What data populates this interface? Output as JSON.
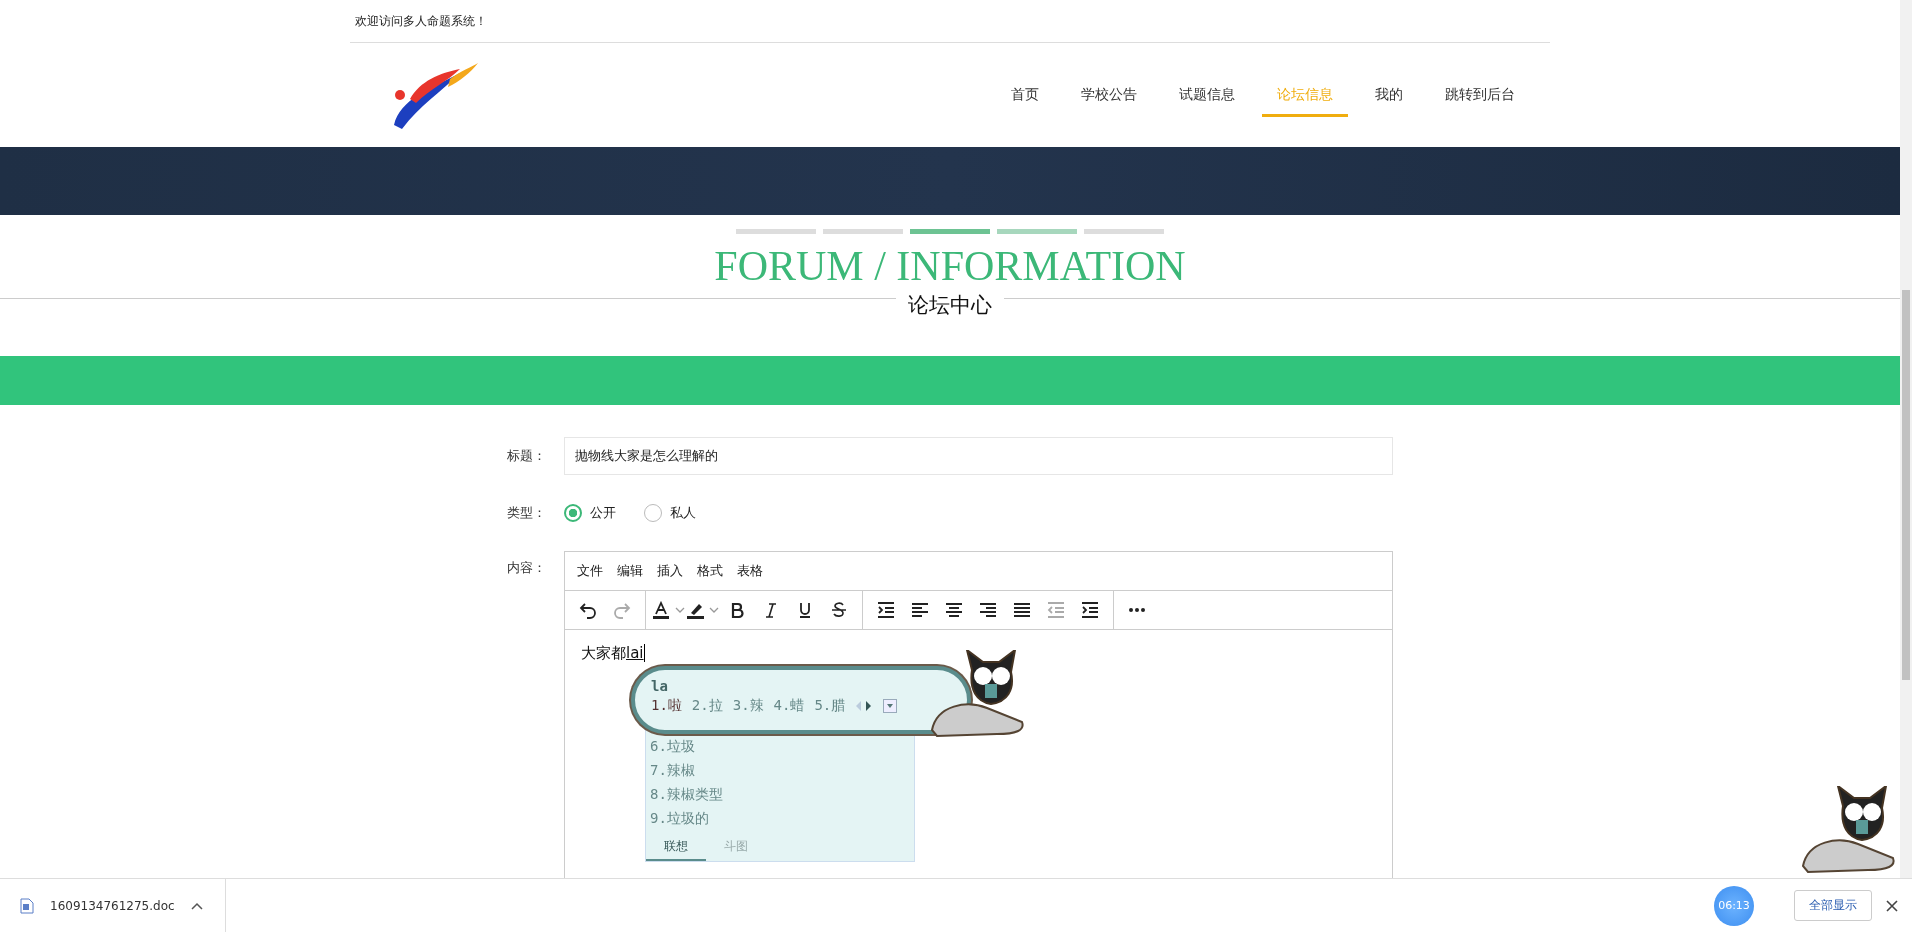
{
  "top_bar": {
    "welcome": "欢迎访问多人命题系统！"
  },
  "nav": {
    "items": [
      {
        "label": "首页",
        "selected": false
      },
      {
        "label": "学校公告",
        "selected": false
      },
      {
        "label": "试题信息",
        "selected": false
      },
      {
        "label": "论坛信息",
        "selected": true
      },
      {
        "label": "我的",
        "selected": false
      },
      {
        "label": "跳转到后台",
        "selected": false
      }
    ]
  },
  "heading": {
    "title": "FORUM / INFORMATION",
    "subtitle": "论坛中心"
  },
  "form": {
    "title_label": "标题：",
    "title_value": "抛物线大家是怎么理解的",
    "type_label": "类型：",
    "type_options": [
      {
        "label": "公开",
        "selected": true
      },
      {
        "label": "私人",
        "selected": false
      }
    ],
    "content_label": "内容：",
    "editor": {
      "menu": [
        "文件",
        "编辑",
        "插入",
        "格式",
        "表格"
      ],
      "toolbar": [
        [
          {
            "kind": "undo",
            "disabled": false
          },
          {
            "kind": "redo",
            "disabled": true
          }
        ],
        [
          {
            "kind": "text-color",
            "disabled": false
          },
          {
            "kind": "highlight",
            "disabled": false
          },
          {
            "kind": "bold",
            "disabled": false
          },
          {
            "kind": "italic",
            "disabled": false
          },
          {
            "kind": "underline",
            "disabled": false
          },
          {
            "kind": "strike",
            "disabled": false
          }
        ],
        [
          {
            "kind": "line-height",
            "disabled": false
          },
          {
            "kind": "align-left",
            "disabled": false
          },
          {
            "kind": "align-center",
            "disabled": false
          },
          {
            "kind": "align-right",
            "disabled": false
          },
          {
            "kind": "justify",
            "disabled": false
          },
          {
            "kind": "outdent",
            "disabled": true
          },
          {
            "kind": "indent",
            "disabled": false
          }
        ],
        [
          {
            "kind": "more",
            "disabled": false
          }
        ]
      ],
      "text": "大家都",
      "composition": "lai"
    }
  },
  "ime": {
    "input": "la",
    "candidates": [
      {
        "label": "1.啦",
        "selected": true
      },
      {
        "label": "2.拉",
        "selected": false
      },
      {
        "label": "3.辣",
        "selected": false
      },
      {
        "label": "4.蜡",
        "selected": false
      },
      {
        "label": "5.腊",
        "selected": false
      }
    ],
    "more_candidates": [
      "6.垃圾",
      "7.辣椒",
      "8.辣椒类型",
      "9.垃圾的"
    ],
    "tabs": [
      {
        "label": "联想",
        "selected": true
      },
      {
        "label": "斗图",
        "selected": false
      }
    ]
  },
  "download_bar": {
    "file": "1609134761275.doc",
    "show_all": "全部显示",
    "clock": "06:13"
  }
}
